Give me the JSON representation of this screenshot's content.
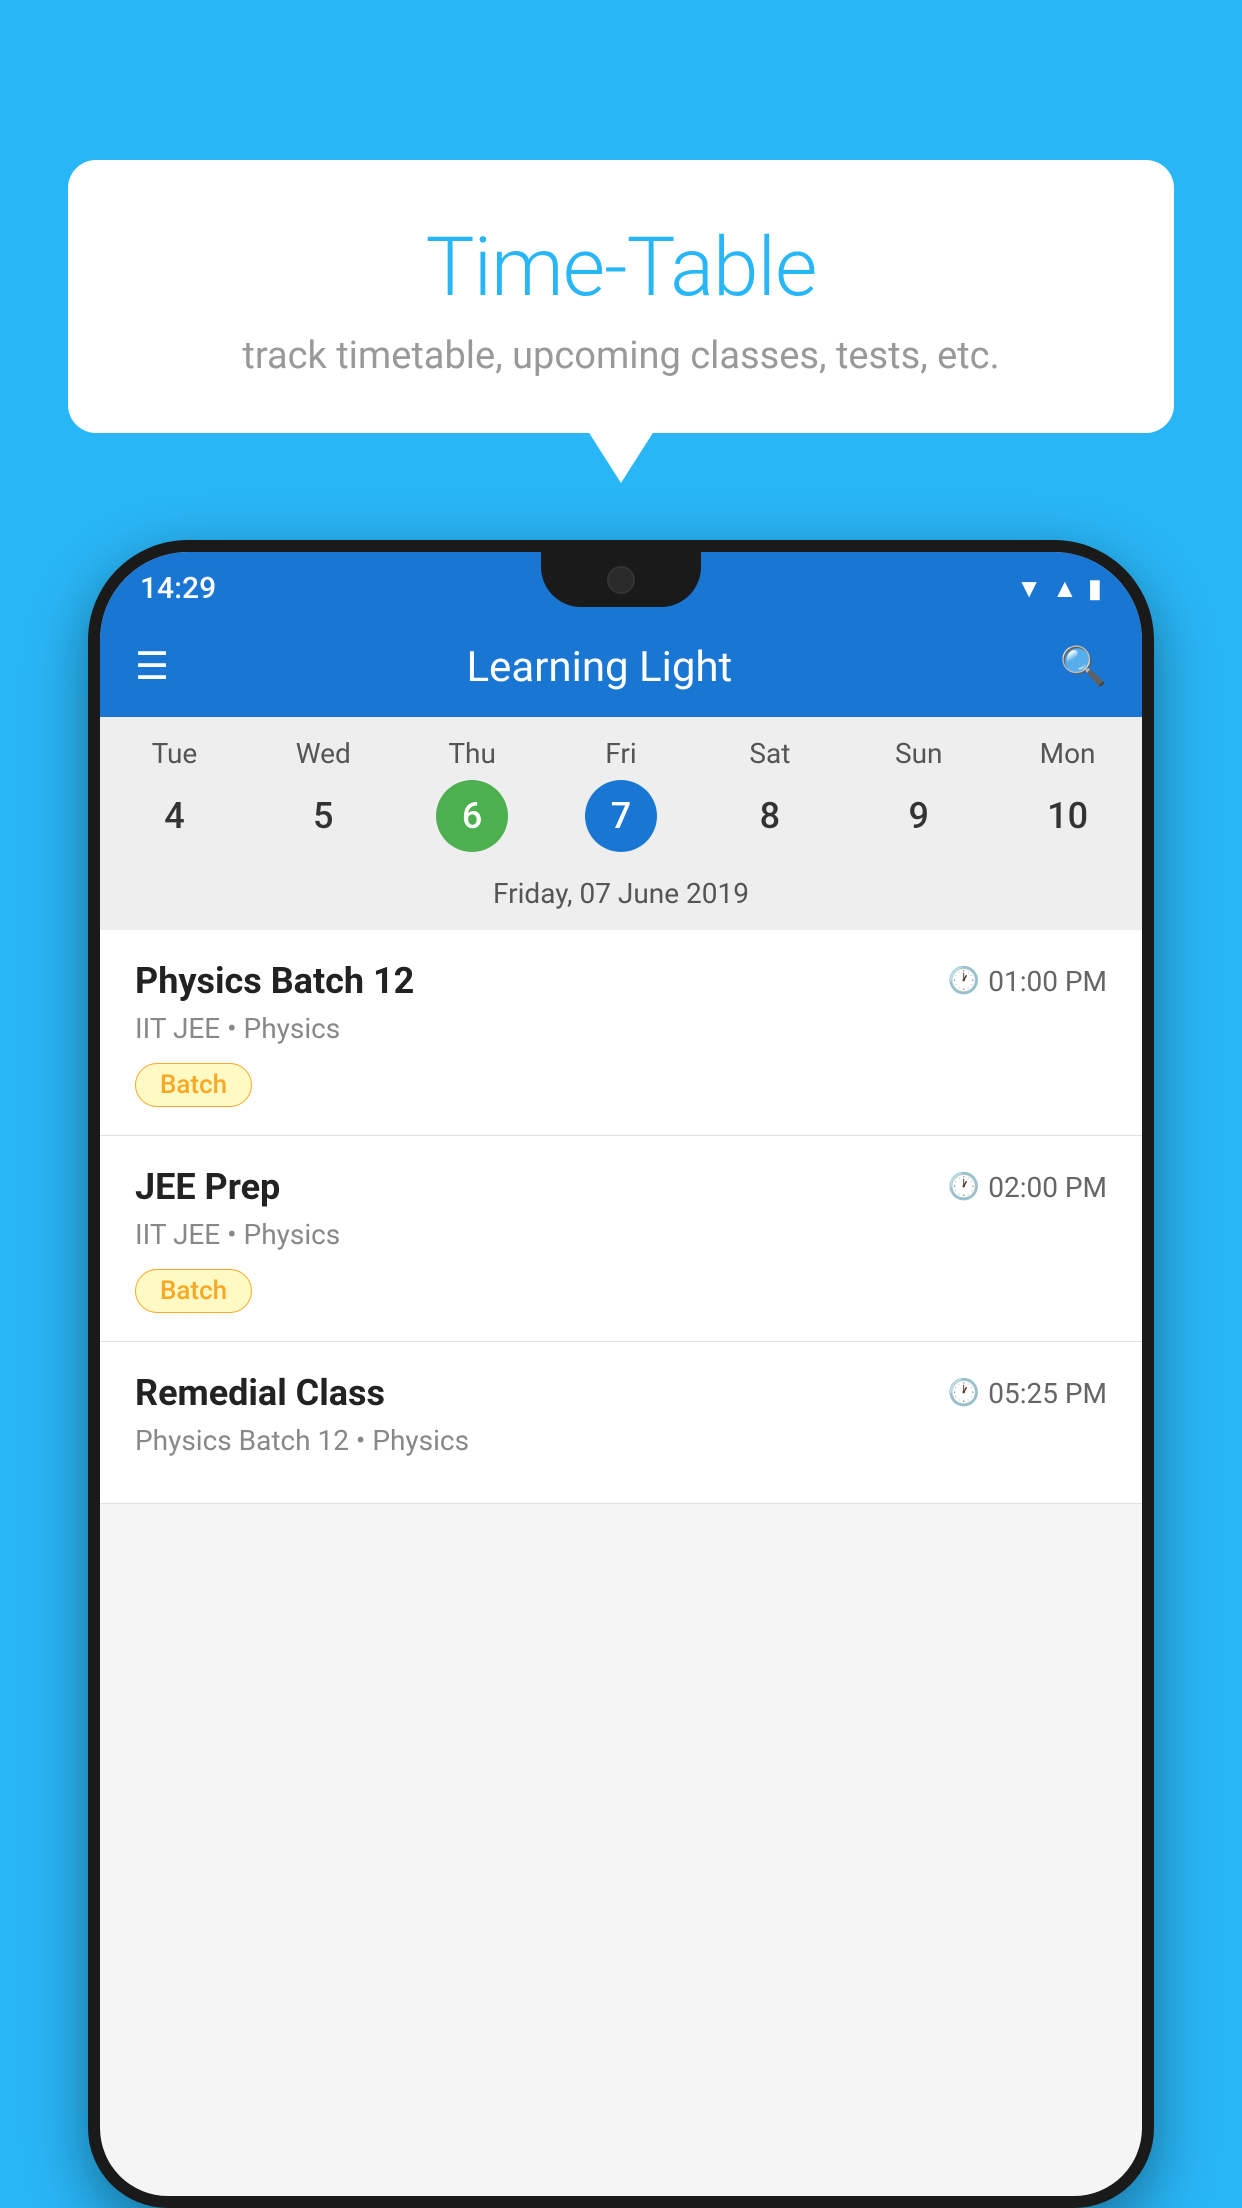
{
  "background_color": "#29B6F6",
  "bubble": {
    "title": "Time-Table",
    "subtitle": "track timetable, upcoming classes, tests, etc."
  },
  "status_bar": {
    "time": "14:29"
  },
  "app_bar": {
    "title": "Learning Light"
  },
  "calendar": {
    "days": [
      "Tue",
      "Wed",
      "Thu",
      "Fri",
      "Sat",
      "Sun",
      "Mon"
    ],
    "dates": [
      "4",
      "5",
      "6",
      "7",
      "8",
      "9",
      "10"
    ],
    "today_index": 2,
    "selected_index": 3,
    "selected_label": "Friday, 07 June 2019"
  },
  "schedule": [
    {
      "title": "Physics Batch 12",
      "time": "01:00 PM",
      "subtitle": "IIT JEE • Physics",
      "badge": "Batch"
    },
    {
      "title": "JEE Prep",
      "time": "02:00 PM",
      "subtitle": "IIT JEE • Physics",
      "badge": "Batch"
    },
    {
      "title": "Remedial Class",
      "time": "05:25 PM",
      "subtitle": "Physics Batch 12 • Physics",
      "badge": ""
    }
  ],
  "labels": {
    "hamburger": "≡",
    "search": "🔍",
    "clock": "🕐",
    "batch": "Batch"
  }
}
